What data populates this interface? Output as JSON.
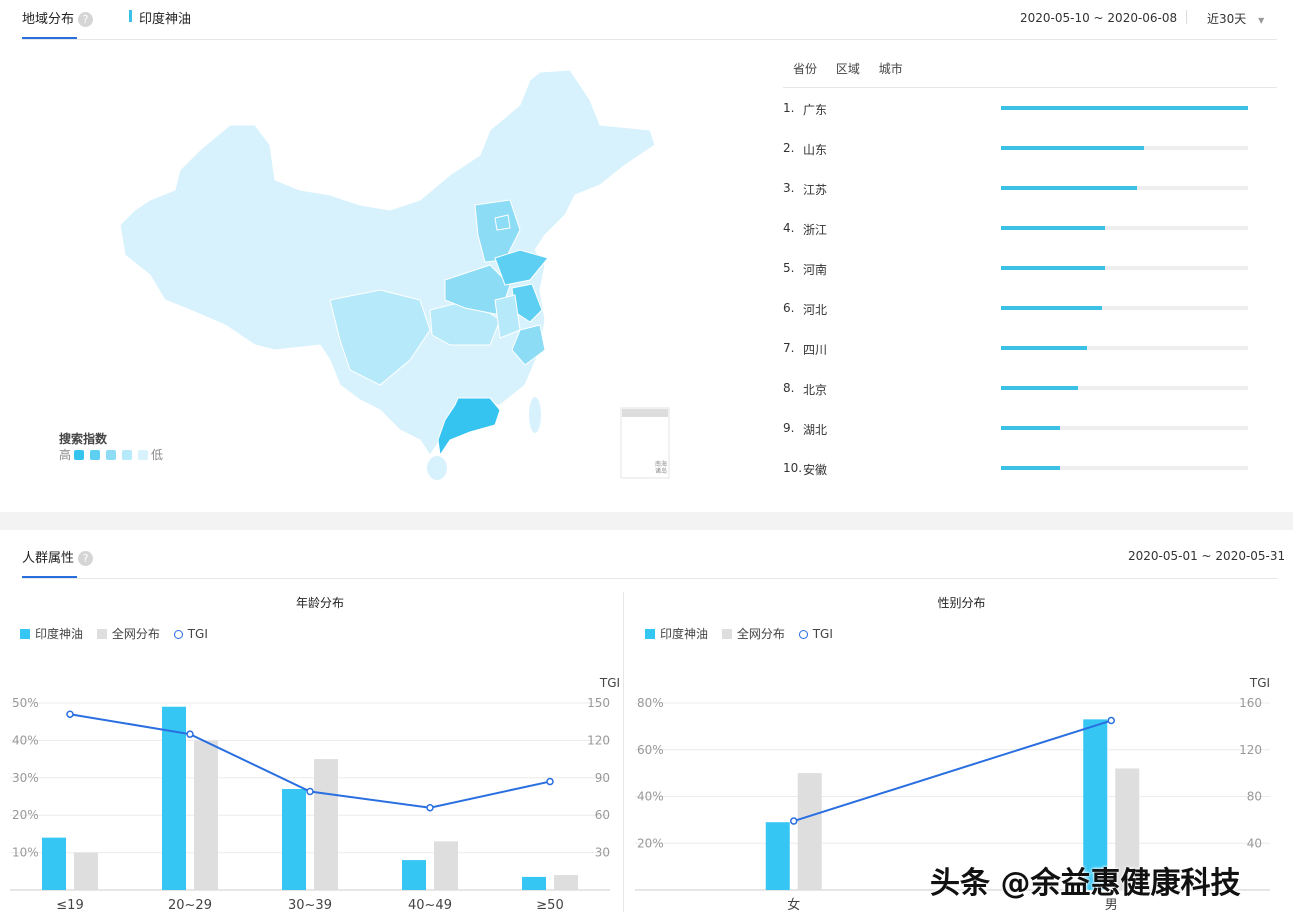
{
  "region": {
    "tab_label": "地域分布",
    "keyword": "印度神油",
    "date_range": "2020-05-10 ~ 2020-06-08",
    "period_select": "近30天",
    "rank_tabs": [
      "省份",
      "区域",
      "城市"
    ],
    "ranking": [
      {
        "rank": "1.",
        "name": "广东",
        "value": 1.0
      },
      {
        "rank": "2.",
        "name": "山东",
        "value": 0.58
      },
      {
        "rank": "3.",
        "name": "江苏",
        "value": 0.55
      },
      {
        "rank": "4.",
        "name": "浙江",
        "value": 0.42
      },
      {
        "rank": "5.",
        "name": "河南",
        "value": 0.42
      },
      {
        "rank": "6.",
        "name": "河北",
        "value": 0.41
      },
      {
        "rank": "7.",
        "name": "四川",
        "value": 0.35
      },
      {
        "rank": "8.",
        "name": "北京",
        "value": 0.31
      },
      {
        "rank": "9.",
        "name": "湖北",
        "value": 0.24
      },
      {
        "rank": "10.",
        "name": "安徽",
        "value": 0.24
      }
    ],
    "map_legend": {
      "title": "搜索指数",
      "high": "高",
      "low": "低",
      "colors": [
        "#35c3ef",
        "#5ccff2",
        "#8cdcf6",
        "#b6e9fa",
        "#d7f2fc"
      ]
    },
    "inset_label": "南海诸岛"
  },
  "crowd": {
    "tab_label": "人群属性",
    "date_range": "2020-05-01 ~ 2020-05-31"
  },
  "legend": {
    "series1": "印度神油",
    "series2": "全网分布",
    "line": "TGI"
  },
  "colors": {
    "series1": "#35c6f4",
    "series2": "#dedede",
    "line": "#2a6fe0",
    "accent": "#2a6fe0"
  },
  "chart_data": [
    {
      "type": "bar",
      "title": "年龄分布",
      "categories": [
        "≤19",
        "20~29",
        "30~39",
        "40~49",
        "≥50"
      ],
      "ylim": [
        0,
        50
      ],
      "yticks": [
        "10%",
        "20%",
        "30%",
        "40%",
        "50%"
      ],
      "y2label": "TGI",
      "y2lim": [
        0,
        150
      ],
      "y2ticks": [
        "30",
        "60",
        "90",
        "120",
        "150"
      ],
      "series": [
        {
          "name": "印度神油",
          "values": [
            14,
            49,
            27,
            8,
            3.5
          ]
        },
        {
          "name": "全网分布",
          "values": [
            10,
            40,
            35,
            13,
            4
          ]
        },
        {
          "name": "TGI",
          "type": "line",
          "axis": "right",
          "values": [
            141,
            125,
            79,
            66,
            87
          ]
        }
      ]
    },
    {
      "type": "bar",
      "title": "性别分布",
      "categories": [
        "女",
        "男"
      ],
      "ylim": [
        0,
        80
      ],
      "yticks": [
        "20%",
        "40%",
        "60%",
        "80%"
      ],
      "y2label": "TGI",
      "y2lim": [
        0,
        160
      ],
      "y2ticks": [
        "40",
        "80",
        "120",
        "160"
      ],
      "series": [
        {
          "name": "印度神油",
          "values": [
            29,
            73
          ]
        },
        {
          "name": "全网分布",
          "values": [
            50,
            52
          ]
        },
        {
          "name": "TGI",
          "type": "line",
          "axis": "right",
          "values": [
            59,
            145
          ]
        }
      ]
    }
  ],
  "watermark": "头条 @余益惠健康科技"
}
